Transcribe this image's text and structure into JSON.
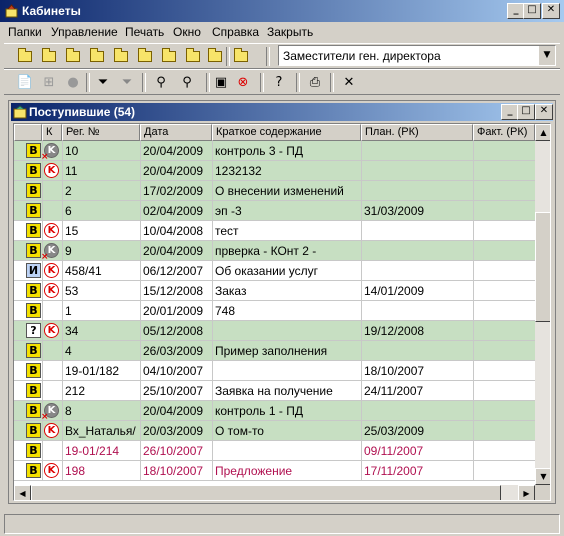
{
  "window": {
    "title": "Кабинеты"
  },
  "menu": [
    "Папки",
    "Управление",
    "Печать",
    "Окно",
    "Справка",
    "Закрыть"
  ],
  "toolbar": {
    "combo_value": "Заместители ген. директора",
    "close_glyph": "✕"
  },
  "child": {
    "title": "Поступившие (54)"
  },
  "columns": [
    "К",
    "Рег. №",
    "Дата",
    "Краткое содержание",
    "План. (РК)",
    "Факт. (РК)"
  ],
  "rows": [
    {
      "type": "В",
      "doc": "yellow",
      "k": "grey",
      "x": true,
      "reg": "10",
      "date": "20/04/2009",
      "summary": "контроль 3 - ПД",
      "plan": "",
      "fact": "",
      "green": true,
      "red": false
    },
    {
      "type": "В",
      "doc": "yellow",
      "k": "red",
      "x": false,
      "reg": "11",
      "date": "20/04/2009",
      "summary": "1232132",
      "plan": "",
      "fact": "",
      "green": true,
      "red": false
    },
    {
      "type": "В",
      "doc": "yellow",
      "k": "",
      "x": false,
      "reg": "2",
      "date": "17/02/2009",
      "summary": "О внесении изменений",
      "plan": "",
      "fact": "",
      "green": true,
      "red": false
    },
    {
      "type": "В",
      "doc": "yellow",
      "k": "",
      "x": false,
      "reg": "6",
      "date": "02/04/2009",
      "summary": "эп -3",
      "plan": "31/03/2009",
      "fact": "",
      "green": true,
      "red": false
    },
    {
      "type": "В",
      "doc": "yellow",
      "k": "red",
      "x": false,
      "reg": "15",
      "date": "10/04/2008",
      "summary": "тест",
      "plan": "",
      "fact": "",
      "green": false,
      "red": false
    },
    {
      "type": "В",
      "doc": "yellow",
      "k": "grey",
      "x": true,
      "reg": "9",
      "date": "20/04/2009",
      "summary": "прверка - КОнт 2 -",
      "plan": "",
      "fact": "",
      "green": true,
      "red": false
    },
    {
      "type": "И",
      "doc": "blue",
      "k": "red",
      "x": false,
      "reg": "458/41",
      "date": "06/12/2007",
      "summary": "Об оказании услуг",
      "plan": "",
      "fact": "",
      "green": false,
      "red": false
    },
    {
      "type": "В",
      "doc": "yellow",
      "k": "red",
      "x": false,
      "reg": "53",
      "date": "15/12/2008",
      "summary": "Заказ",
      "plan": "14/01/2009",
      "fact": "",
      "green": false,
      "red": false
    },
    {
      "type": "В",
      "doc": "yellow",
      "k": "",
      "x": false,
      "reg": "1",
      "date": "20/01/2009",
      "summary": "748",
      "plan": "",
      "fact": "",
      "green": false,
      "red": false
    },
    {
      "type": "?",
      "doc": "white",
      "k": "red",
      "x": false,
      "reg": "34",
      "date": "05/12/2008",
      "summary": "",
      "plan": "19/12/2008",
      "fact": "",
      "green": true,
      "red": false
    },
    {
      "type": "В",
      "doc": "yellow",
      "k": "",
      "x": false,
      "reg": "4",
      "date": "26/03/2009",
      "summary": "Пример заполнения",
      "plan": "",
      "fact": "",
      "green": true,
      "red": false
    },
    {
      "type": "В",
      "doc": "yellow",
      "k": "",
      "x": false,
      "reg": "19-01/182",
      "date": "04/10/2007",
      "summary": "",
      "plan": "18/10/2007",
      "fact": "",
      "green": false,
      "red": false
    },
    {
      "type": "В",
      "doc": "yellow",
      "k": "",
      "x": false,
      "reg": "212",
      "date": "25/10/2007",
      "summary": "Заявка на получение",
      "plan": "24/11/2007",
      "fact": "",
      "green": false,
      "red": false
    },
    {
      "type": "В",
      "doc": "yellow",
      "k": "grey",
      "x": true,
      "reg": "8",
      "date": "20/04/2009",
      "summary": "контроль 1 - ПД",
      "plan": "",
      "fact": "",
      "green": true,
      "red": false
    },
    {
      "type": "В",
      "doc": "yellow",
      "k": "red",
      "x": false,
      "reg": "Вх_Наталья/",
      "date": "20/03/2009",
      "summary": "О том-то",
      "plan": "25/03/2009",
      "fact": "",
      "green": true,
      "red": false
    },
    {
      "type": "В",
      "doc": "yellow",
      "k": "",
      "x": false,
      "reg": "19-01/214",
      "date": "26/10/2007",
      "summary": "",
      "plan": "09/11/2007",
      "fact": "",
      "green": false,
      "red": true
    },
    {
      "type": "В",
      "doc": "yellow",
      "k": "red",
      "x": false,
      "reg": "198",
      "date": "18/10/2007",
      "summary": "Предложение",
      "plan": "17/11/2007",
      "fact": "",
      "green": false,
      "red": true
    }
  ]
}
